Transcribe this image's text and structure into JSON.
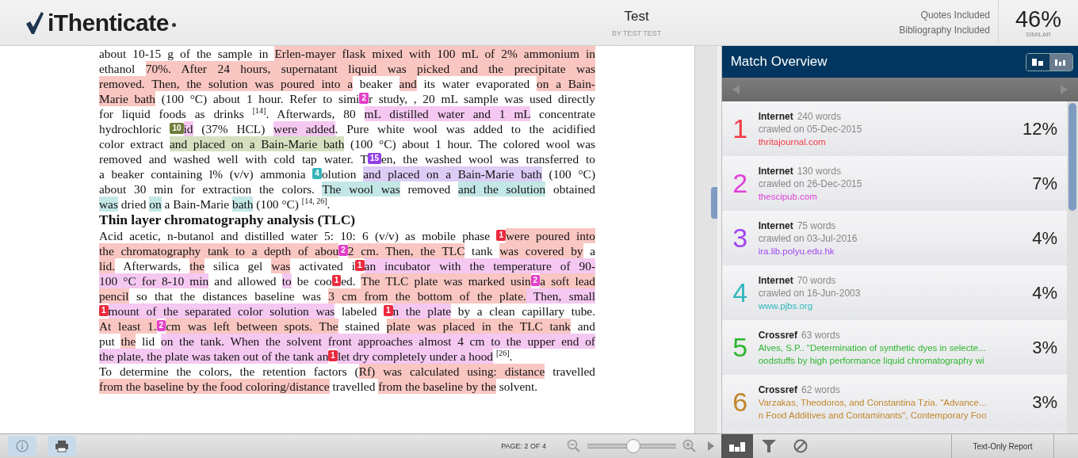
{
  "header": {
    "logo": "iThenticate",
    "title": "Test",
    "author": "BY TEST TEST",
    "options": [
      "Quotes Included",
      "Bibliography Included"
    ],
    "similarity": "46%",
    "similarity_label": "SIMILAR"
  },
  "document": {
    "paragraphs": [
      {
        "kind": "text",
        "lines": [
          [
            {
              "text": "about 10-15 g of the sample in "
            },
            {
              "text": "Erlen-mayer flask mixed with 100 mL of 2% ammonium in",
              "color": "#f9c6c1"
            }
          ],
          [
            {
              "text": "ethanol "
            },
            {
              "text": "70%. After 24 hours, supernatant liquid was picked and the precipitate was",
              "color": "#f9c6c1"
            }
          ],
          [
            {
              "text": "removed. Then, the solution was poured into a",
              "color": "#f9c6c1"
            },
            {
              "text": " beaker "
            },
            {
              "text": "and",
              "color": "#f9c6c1"
            },
            {
              "text": " its water evaporated "
            },
            {
              "text": "on a Bain-",
              "color": "#f9c6c1"
            }
          ],
          [
            {
              "text": "Marie bath",
              "color": "#f9c6c1"
            },
            {
              "text": " (100 °C) about 1 hour. Refer to simi"
            },
            {
              "marker": "2",
              "color": "#e23fc8"
            },
            {
              "text": "r study, , 20 mL sample was used directly"
            }
          ],
          [
            {
              "text": "for liquid foods as drinks $^{[14]}$. Afterwards, 80 "
            },
            {
              "text": "mL distilled water and 1 mL",
              "color": "#f5c8f1"
            },
            {
              "text": " concentrate"
            }
          ],
          [
            {
              "text": "hydrochloric "
            },
            {
              "marker": "10",
              "color": "#6e7d3a"
            },
            {
              "text": "id",
              "color": "#f5c8f1"
            },
            {
              "text": " (37% HCL) "
            },
            {
              "text": "were added",
              "color": "#f5c8f1"
            },
            {
              "text": ". Pure white wool was added to the acidified"
            }
          ],
          [
            {
              "text": "color extract "
            },
            {
              "text": "and placed on a Bain-Marie bath",
              "color": "#d6e0c0"
            },
            {
              "text": " (100 °C) about 1 hour. The colored wool was"
            }
          ],
          [
            {
              "text": "removed and washed well with cold tap water. T"
            },
            {
              "marker": "15",
              "color": "#9340e6"
            },
            {
              "text": "en, the washed wool was transferred to"
            }
          ],
          [
            {
              "text": "a beaker containing l% (v/v) ammonia "
            },
            {
              "marker": "4",
              "color": "#35b5b8"
            },
            {
              "text": "olution "
            },
            {
              "text": "and placed on a Bain-Marie bath",
              "color": "#dcccf6"
            },
            {
              "text": " (100 °C)"
            }
          ],
          [
            {
              "text": "about 30 min for extraction the colors. "
            },
            {
              "text": "The wool was",
              "color": "#c3e7e6"
            },
            {
              "text": " removed "
            },
            {
              "text": "and the solution",
              "color": "#c3e7e6"
            },
            {
              "text": " obtained"
            }
          ],
          [
            {
              "text": "was",
              "color": "#c3e7e6"
            },
            {
              "text": " dried "
            },
            {
              "text": "on",
              "color": "#c3e7e6"
            },
            {
              "text": " a Bain-Marie "
            },
            {
              "text": "bath",
              "color": "#c3e7e6"
            },
            {
              "text": " (100 °C) $^{[14, 26]}$."
            }
          ]
        ]
      },
      {
        "kind": "heading",
        "lines": [
          [
            {
              "text": "Thin layer chromatography analysis (TLC)"
            }
          ]
        ]
      },
      {
        "kind": "text",
        "lines": [
          [
            {
              "text": "Acid acetic, n-butanol and distilled water 5: 10: 6 (v/v) as mobile phase "
            },
            {
              "marker": "1",
              "color": "#ec2a3e"
            },
            {
              "text": "were poured into",
              "color": "#f9c6c1"
            }
          ],
          [
            {
              "text": "the chromatography tank to a depth of abou",
              "color": "#f9c6c1"
            },
            {
              "marker": "2",
              "color": "#e23fc8"
            },
            {
              "text": "2 cm. Then, the TLC",
              "color": "#f9c6c1"
            },
            {
              "text": " tank "
            },
            {
              "text": "was covered by",
              "color": "#f9c6c1"
            },
            {
              "text": " a"
            }
          ],
          [
            {
              "text": "lid.",
              "color": "#f9c6c1"
            },
            {
              "text": "  Afterwards, "
            },
            {
              "text": "the",
              "color": "#f9c6c1"
            },
            {
              "text": " silica gel "
            },
            {
              "text": "was",
              "color": "#f9c6c1"
            },
            {
              "text": " activated i"
            },
            {
              "marker": "1",
              "color": "#ec2a3e"
            },
            {
              "text": "an incubator with the temperature of 90-",
              "color": "#f5c8f1"
            }
          ],
          [
            {
              "text": "100 °C for 8-10 min",
              "color": "#f5c8f1"
            },
            {
              "text": " and allowed "
            },
            {
              "text": "to",
              "color": "#f5c8f1"
            },
            {
              "text": " be coo"
            },
            {
              "marker": "1",
              "color": "#ec2a3e"
            },
            {
              "text": "ed. "
            },
            {
              "text": "The TLC plate was marked usin",
              "color": "#f9c6c1"
            },
            {
              "marker": "2",
              "color": "#e23fc8"
            },
            {
              "text": "a soft lead",
              "color": "#f9c6c1"
            }
          ],
          [
            {
              "text": "pencil",
              "color": "#f9c6c1"
            },
            {
              "text": " so that the distances baseline was "
            },
            {
              "text": "3 cm from the bottom of the plate.",
              "color": "#f9c6c1"
            },
            {
              "text": " Then, small",
              "color": "#f5c8f1"
            }
          ],
          [
            {
              "marker": "1",
              "color": "#ec2a3e"
            },
            {
              "text": "mount of the separated color solution was",
              "color": "#f5c8f1"
            },
            {
              "text": " labeled "
            },
            {
              "marker": "1",
              "color": "#ec2a3e"
            },
            {
              "text": "n the plate",
              "color": "#f5c8f1"
            },
            {
              "text": " by a clean capillary tube."
            }
          ],
          [
            {
              "text": "At least 1.",
              "color": "#f9c6c1"
            },
            {
              "marker": "2",
              "color": "#e23fc8"
            },
            {
              "text": "cm was left between spots. The",
              "color": "#f9c6c1"
            },
            {
              "text": " stained "
            },
            {
              "text": "plate was placed in the TLC tank",
              "color": "#f9c6c1"
            },
            {
              "text": " and"
            }
          ],
          [
            {
              "text": "put "
            },
            {
              "text": "the",
              "color": "#f9c6c1"
            },
            {
              "text": " lid "
            },
            {
              "text": "on the tank. When the solvent front approaches almost 4 cm to the upper end of",
              "color": "#f5c8f1"
            }
          ],
          [
            {
              "text": "the plate, the plate was taken out of the tank an",
              "color": "#f5c8f1"
            },
            {
              "marker": "1",
              "color": "#ec2a3e"
            },
            {
              "text": "let dry completely under a hood",
              "color": "#f5c8f1"
            },
            {
              "text": " $^{[26]}$."
            }
          ]
        ]
      },
      {
        "kind": "text",
        "lines": [
          [
            {
              "text": "To determine the colors, the retention factors ("
            },
            {
              "text": "Rf) was calculated using: distance",
              "color": "#f9c6c1"
            },
            {
              "text": " travelled"
            }
          ],
          [
            {
              "text": "from the baseline by the food coloring/distance",
              "color": "#f9c6c1"
            },
            {
              "text": " travelled "
            },
            {
              "text": "from the baseline by the",
              "color": "#f9c6c1"
            },
            {
              "text": " solvent."
            }
          ]
        ]
      }
    ]
  },
  "viewer_bar": {
    "page": "PAGE: 2 OF 4",
    "zoom": {
      "level": 0.52
    }
  },
  "match_overview": {
    "title": "Match Overview",
    "views": [
      {
        "kind": "blocks",
        "selected": false
      },
      {
        "kind": "bars",
        "selected": true
      }
    ],
    "sources": [
      {
        "number": "1",
        "type": "Internet",
        "words": "240 words",
        "lines": [
          "crawled on 05-Dec-2015"
        ],
        "link": [
          "thritajournal.com"
        ],
        "percent": "12%",
        "color": "#f23a45"
      },
      {
        "number": "2",
        "type": "Internet",
        "words": "130 words",
        "lines": [
          "crawled on 26-Dec-2015"
        ],
        "link": [
          "thescipub.com"
        ],
        "percent": "7%",
        "color": "#e040d8"
      },
      {
        "number": "3",
        "type": "Internet",
        "words": "75 words",
        "lines": [
          "crawled on 03-Jul-2016"
        ],
        "link": [
          "ira.lib.polyu.edu.hk"
        ],
        "percent": "4%",
        "color": "#a046f0"
      },
      {
        "number": "4",
        "type": "Internet",
        "words": "70 words",
        "lines": [
          "crawled on 16-Jun-2003"
        ],
        "link": [
          "www.pjbs.org"
        ],
        "percent": "4%",
        "color": "#2fb8bd"
      },
      {
        "number": "5",
        "type": "Crossref",
        "words": "63 words",
        "link": [
          "Alves, S.P.. \"Determination of synthetic dyes in selecte...",
          "oodstuffs by high performance liquid chromatography wi"
        ],
        "percent": "3%",
        "color": "#2fb62f"
      },
      {
        "number": "6",
        "type": "Crossref",
        "words": "62 words",
        "link": [
          "Varzakas, Theodoros, and Constantina Tzia. \"Advance...",
          "n Food Additives and Contaminants\", Contemporary Foo"
        ],
        "percent": "3%",
        "color": "#c0862a"
      }
    ],
    "tools": [
      {
        "kind": "bars",
        "selected": true
      },
      {
        "kind": "filter",
        "selected": false
      },
      {
        "kind": "exclude",
        "selected": false
      }
    ],
    "report_button": "Text-Only Report"
  }
}
